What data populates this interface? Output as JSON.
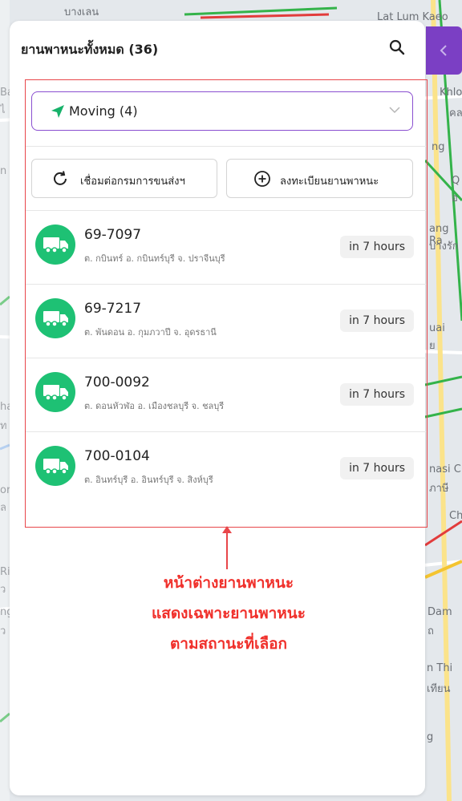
{
  "panel": {
    "title": "ยานพาหนะทั้งหมด (36)"
  },
  "status_filter": {
    "selected": "Moving (4)"
  },
  "actions": {
    "connect_label": "เชื่อมต่อกรมการขนส่งฯ",
    "register_label": "ลงทะเบียนยานพาหนะ"
  },
  "vehicles": [
    {
      "plate": "69-7097",
      "location": "ต. กบินทร์ อ. กบินทร์บุรี จ. ปราจีนบุรี",
      "eta": "in 7 hours"
    },
    {
      "plate": "69-7217",
      "location": "ต. พันดอน อ. กุมภวาปี จ. อุดรธานี",
      "eta": "in 7 hours"
    },
    {
      "plate": "700-0092",
      "location": "ต. ดอนหัวฬ่อ อ. เมืองชลบุรี จ. ชลบุรี",
      "eta": "in 7 hours"
    },
    {
      "plate": "700-0104",
      "location": "ต. อินทร์บุรี อ. อินทร์บุรี จ. สิงห์บุรี",
      "eta": "in 7 hours"
    }
  ],
  "annotation": {
    "line1": "หน้าต่างยานพาหนะ",
    "line2": "แสดงเฉพาะยานพาหนะ",
    "line3": "ตามสถานะที่เลือก"
  },
  "map_labels": {
    "top_left": "บางเลน",
    "top_right": "Lat Lum Kaeo",
    "r1": "Khlo",
    "r2": "คล",
    "r3": "ng",
    "r4": "Q",
    "r5": "อ",
    "r6": "ang Ra",
    "r7": "บางรัก",
    "r8": "uai",
    "r9": "ย",
    "r10": "nasi C",
    "r11": "ภาษี",
    "r12": "Ch",
    "r13": "Dam",
    "r14": "ถ",
    "r15": "n Thi",
    "r16": "เทียน",
    "r17": "g",
    "l1": "Ba",
    "l2": "ไ",
    "l3": "n",
    "l4": "ha",
    "l5": "ท",
    "l6": "or",
    "l7": "ล",
    "l8": "Ri",
    "l9": "ว",
    "l10": "ng",
    "l11": "ว"
  },
  "colors": {
    "accent": "#8a4fd0",
    "tab": "#7b3fc4",
    "moving": "#1ec174",
    "annotation": "#f0302b"
  },
  "icons": {
    "search": "search-icon",
    "collapse": "chevron-left-icon",
    "status": "navigation-arrow-icon",
    "dropdown": "chevron-down-icon",
    "connect": "refresh-icon",
    "register": "plus-circle-icon",
    "vehicle": "truck-icon"
  }
}
